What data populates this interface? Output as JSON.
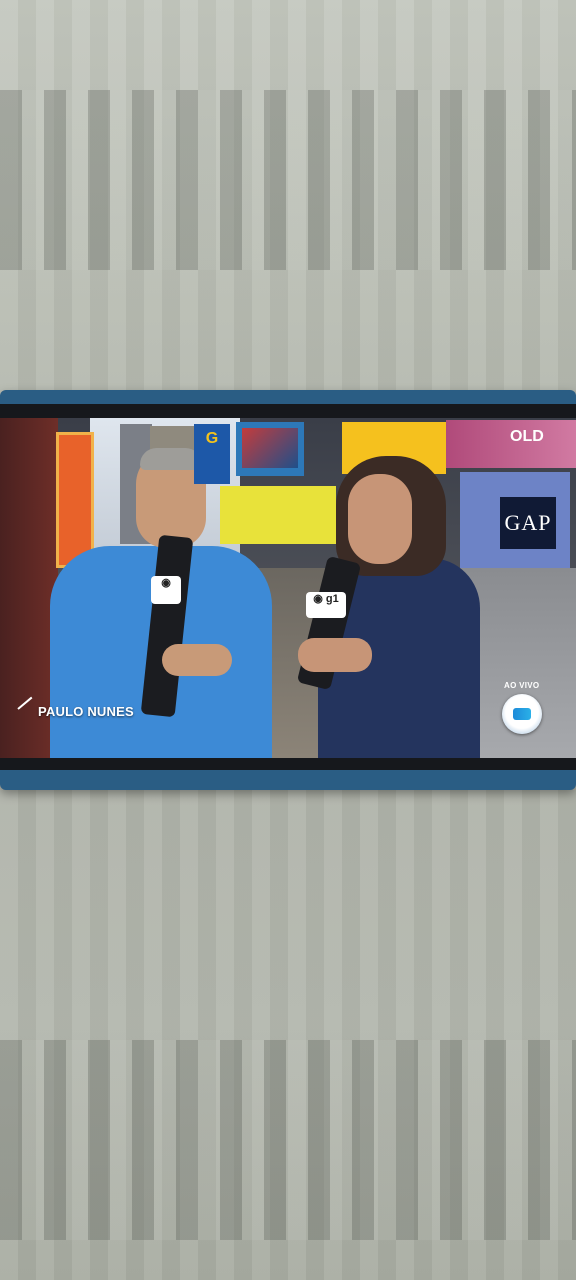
{
  "broadcast": {
    "name_caption": "PAULO NUNES",
    "live_label": "AO VIVO"
  },
  "signage": {
    "gap": "GAP",
    "old": "OLD",
    "gl": "G"
  },
  "icons": {
    "channel_logo": "globo-logo-icon"
  },
  "colors": {
    "phone_case": "#2a5d84",
    "shirt_blue": "#3d8ad6",
    "blazer_navy": "#24345e",
    "sign_yellow": "#f5c11e",
    "sign_orange": "#e8612a"
  }
}
